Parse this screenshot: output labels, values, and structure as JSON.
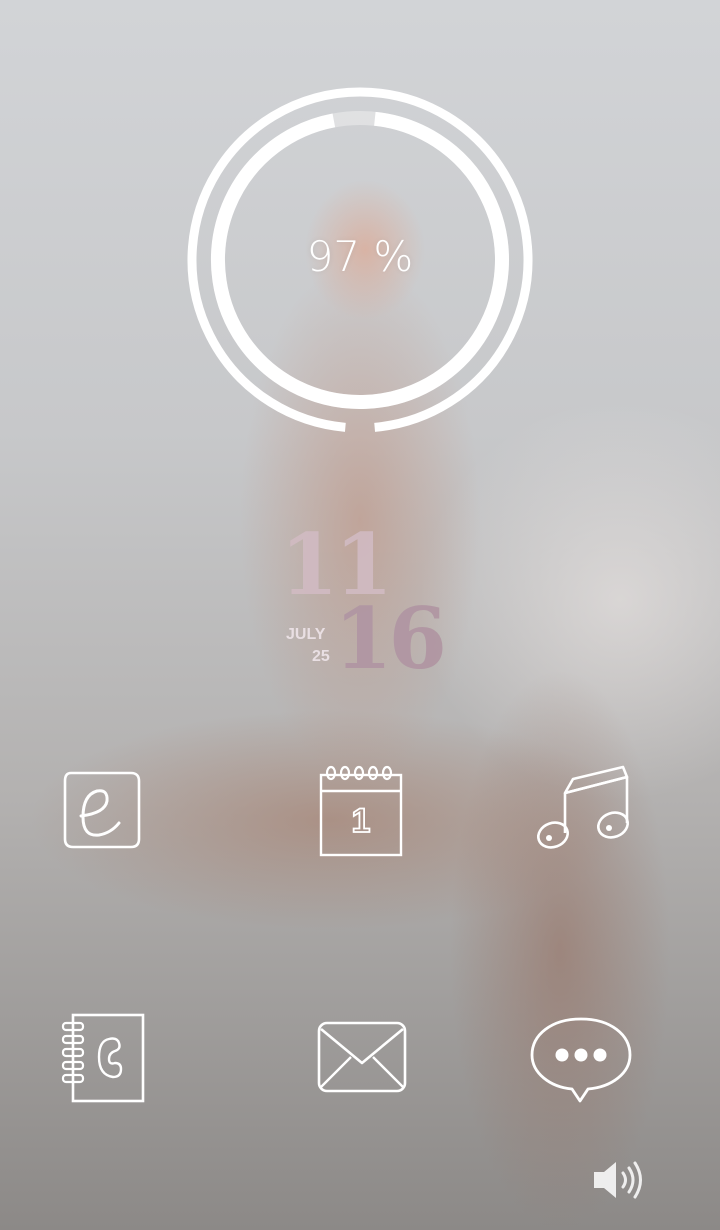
{
  "battery": {
    "percent_label": "97 %",
    "level": 0.97
  },
  "clock": {
    "hour": "11",
    "minute": "16",
    "month": "JULY",
    "day": "25"
  },
  "apps": [
    {
      "name": "browser",
      "icon": "browser-e-icon"
    },
    {
      "name": "calendar",
      "icon": "calendar-icon",
      "calendar_day": "1"
    },
    {
      "name": "music",
      "icon": "music-note-icon"
    },
    {
      "name": "contacts",
      "icon": "contacts-book-icon"
    },
    {
      "name": "email",
      "icon": "envelope-icon"
    },
    {
      "name": "messages",
      "icon": "chat-bubble-icon"
    }
  ],
  "controls": {
    "volume_icon": "speaker-volume-icon"
  },
  "colors": {
    "icon_stroke": "#ffffff",
    "clock_hour": "#d0bac2",
    "clock_minute": "#b096a2"
  }
}
